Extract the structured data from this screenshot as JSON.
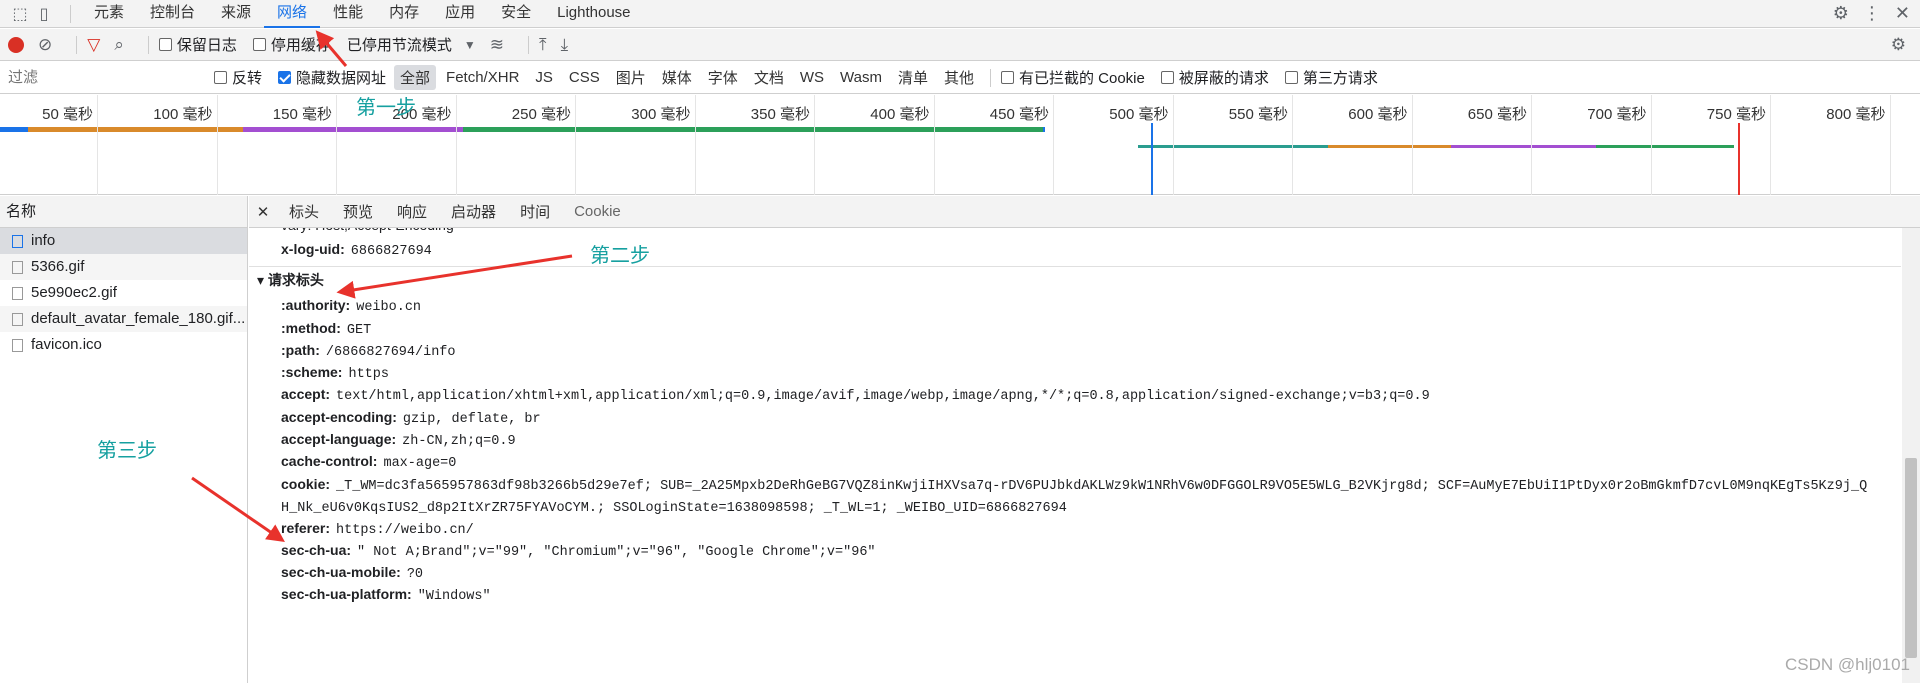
{
  "tabs": [
    "元素",
    "控制台",
    "来源",
    "网络",
    "性能",
    "内存",
    "应用",
    "安全",
    "Lighthouse"
  ],
  "active_tab": "网络",
  "toolbar": {
    "preserve_log": "保留日志",
    "disable_cache": "停用缓存",
    "throttle": "已停用节流模式"
  },
  "filter": {
    "placeholder": "过滤",
    "invert": "反转",
    "hide_data_urls": "隐藏数据网址",
    "types": [
      "全部",
      "Fetch/XHR",
      "JS",
      "CSS",
      "图片",
      "媒体",
      "字体",
      "文档",
      "WS",
      "Wasm",
      "清单",
      "其他"
    ],
    "blocked_cookies": "有已拦截的 Cookie",
    "blocked_requests": "被屏蔽的请求",
    "third_party": "第三方请求"
  },
  "timeline_ticks": [
    "50 毫秒",
    "100 毫秒",
    "150 毫秒",
    "200 毫秒",
    "250 毫秒",
    "300 毫秒",
    "350 毫秒",
    "400 毫秒",
    "450 毫秒",
    "500 毫秒",
    "550 毫秒",
    "600 毫秒",
    "650 毫秒",
    "700 毫秒",
    "750 毫秒",
    "800 毫秒"
  ],
  "names_header": "名称",
  "requests": [
    "info",
    "5366.gif",
    "5e990ec2.gif",
    "default_avatar_female_180.gif...",
    "favicon.ico"
  ],
  "detail_tabs": [
    "标头",
    "预览",
    "响应",
    "启动器",
    "时间",
    "Cookie"
  ],
  "partial_row": "vary: Host,Accept-Encoding",
  "response_headers": [
    {
      "name": "x-log-uid:",
      "value": "6866827694"
    }
  ],
  "request_section": "请求标头",
  "request_headers": [
    {
      "name": ":authority:",
      "value": "weibo.cn"
    },
    {
      "name": ":method:",
      "value": "GET"
    },
    {
      "name": ":path:",
      "value": "/6866827694/info"
    },
    {
      "name": ":scheme:",
      "value": "https"
    },
    {
      "name": "accept:",
      "value": "text/html,application/xhtml+xml,application/xml;q=0.9,image/avif,image/webp,image/apng,*/*;q=0.8,application/signed-exchange;v=b3;q=0.9"
    },
    {
      "name": "accept-encoding:",
      "value": "gzip, deflate, br"
    },
    {
      "name": "accept-language:",
      "value": "zh-CN,zh;q=0.9"
    },
    {
      "name": "cache-control:",
      "value": "max-age=0"
    },
    {
      "name": "cookie:",
      "value": "_T_WM=dc3fa565957863df98b3266b5d29e7ef; SUB=_2A25Mpxb2DeRhGeBG7VQZ8inKwjiIHXVsa7q-rDV6PUJbkdAKLWz9kW1NRhV6w0DFGGOLR9VO5E5WLG_B2VKjrg8d; SCF=AuMyE7EbUiI1PtDyx0r2oBmGkmfD7cvL0M9nqKEgTs5Kz9j_Q"
    },
    {
      "name": "",
      "value": "H_Nk_eU6v0KqsIUS2_d8p2ItXrZR75FYAVoCYM.; SSOLoginState=1638098598; _T_WL=1; _WEIBO_UID=6866827694"
    },
    {
      "name": "referer:",
      "value": "https://weibo.cn/"
    },
    {
      "name": "sec-ch-ua:",
      "value": "\" Not A;Brand\";v=\"99\", \"Chromium\";v=\"96\", \"Google Chrome\";v=\"96\""
    },
    {
      "name": "sec-ch-ua-mobile:",
      "value": "?0"
    },
    {
      "name": "sec-ch-ua-platform:",
      "value": "\"Windows\""
    }
  ],
  "annotations": {
    "step1": "第一步",
    "step2": "第二步",
    "step3": "第三步"
  },
  "watermark": "CSDN @hlj0101",
  "colors": {
    "accent": "#1a73e8",
    "record": "#d93025",
    "annotation": "#16a0a0",
    "arrow": "#e8322c"
  }
}
